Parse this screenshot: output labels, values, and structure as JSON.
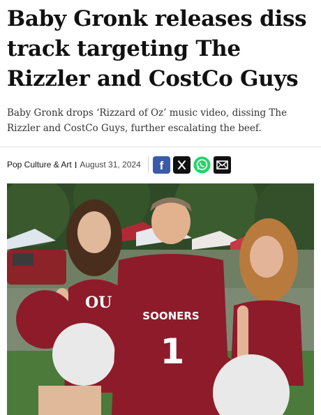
{
  "article": {
    "headline": "Baby Gronk releases diss track targeting The Rizzler and CostCo Guys",
    "subheadline": "Baby Gronk drops ‘Rizzard of Oz’ music video, dissing The Rizzler and CostCo Guys, further escalating the beef.",
    "category": "Pop Culture & Art",
    "separator": "I",
    "date": "August 31, 2024"
  },
  "share": {
    "icons": [
      "facebook-icon",
      "x-icon",
      "whatsapp-icon",
      "email-icon"
    ],
    "facebook_letter": "f",
    "x_letter": "𝕏"
  },
  "photo": {
    "jersey_text": "SOONERS",
    "jersey_number": "1",
    "cheer_logo": "OU",
    "colors": {
      "crimson": "#8e1b2a",
      "pompom_white": "#e9e9e9",
      "grass": "#4b7a3a",
      "trees": "#2f4a26"
    }
  }
}
